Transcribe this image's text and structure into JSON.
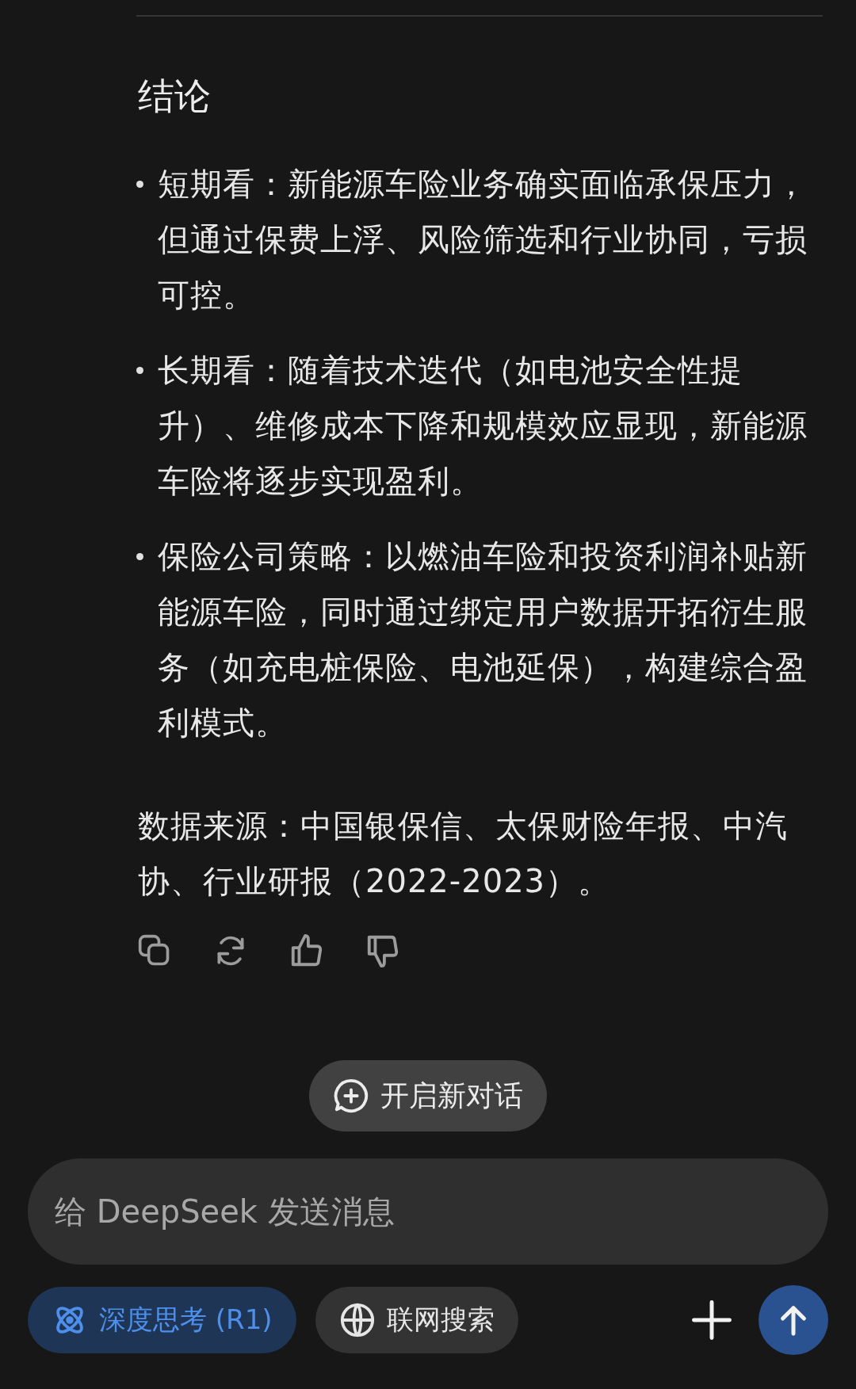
{
  "heading": "结论",
  "bullets": [
    "短期看：新能源车险业务确实面临承保压力，但通过保费上浮、风险筛选和行业协同，亏损可控。",
    "长期看：随着技术迭代（如电池安全性提升）、维修成本下降和规模效应显现，新能源车险将逐步实现盈利。",
    "保险公司策略：以燃油车险和投资利润补贴新能源车险，同时通过绑定用户数据开拓衍生服务（如充电桩保险、电池延保），构建综合盈利模式。"
  ],
  "source": "数据来源：中国银保信、太保财险年报、中汽协、行业研报（2022-2023）。",
  "new_chat": {
    "label": "开启新对话"
  },
  "composer": {
    "placeholder": "给 DeepSeek 发送消息"
  },
  "toggles": [
    {
      "kind": "deep",
      "label": "深度思考 (R1)",
      "selected": true
    },
    {
      "kind": "web",
      "label": "联网搜索",
      "selected": false
    }
  ]
}
